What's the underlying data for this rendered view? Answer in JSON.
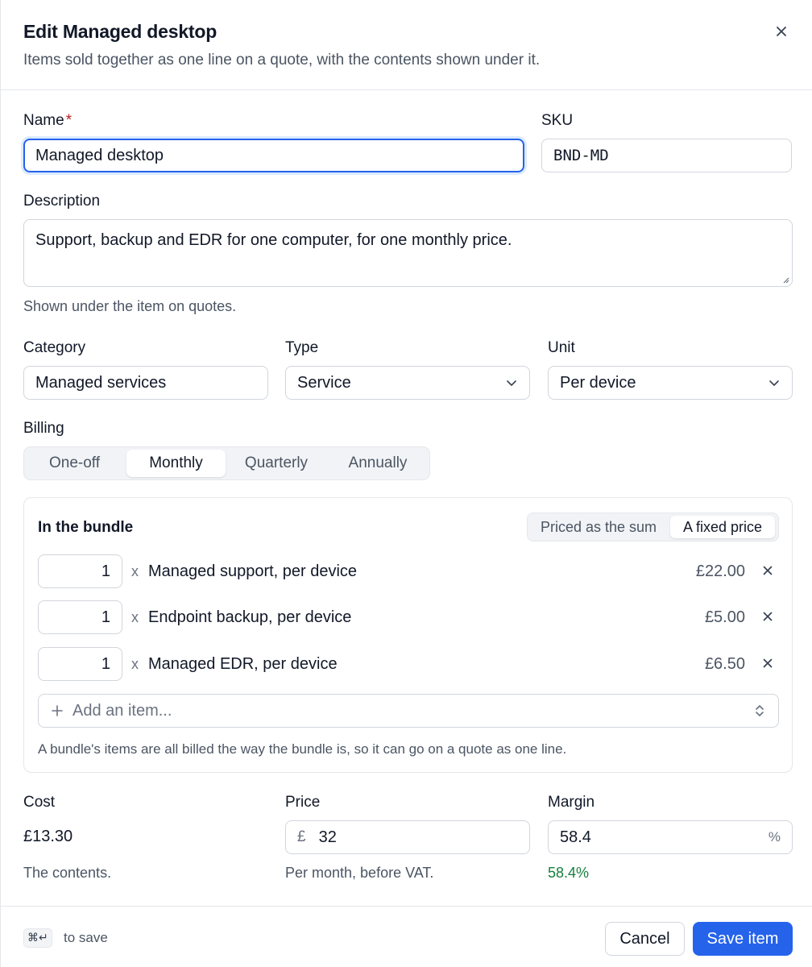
{
  "dialog": {
    "title": "Edit Managed desktop",
    "subtitle": "Items sold together as one line on a quote, with the contents shown under it."
  },
  "fields": {
    "name": {
      "label": "Name",
      "required_mark": "*",
      "value": "Managed desktop"
    },
    "sku": {
      "label": "SKU",
      "value": "BND-MD"
    },
    "description": {
      "label": "Description",
      "value": "Support, backup and EDR for one computer, for one monthly price.",
      "hint": "Shown under the item on quotes."
    },
    "category": {
      "label": "Category",
      "value": "Managed services"
    },
    "type": {
      "label": "Type",
      "value": "Service"
    },
    "unit": {
      "label": "Unit",
      "value": "Per device"
    }
  },
  "billing": {
    "label": "Billing",
    "options": [
      "One-off",
      "Monthly",
      "Quarterly",
      "Annually"
    ],
    "selected": "Monthly"
  },
  "bundle": {
    "title": "In the bundle",
    "pricing_options": [
      "Priced as the sum",
      "A fixed price"
    ],
    "pricing_selected": "A fixed price",
    "times_symbol": "x",
    "items": [
      {
        "qty": "1",
        "name": "Managed support, per device",
        "price": "£22.00"
      },
      {
        "qty": "1",
        "name": "Endpoint backup, per device",
        "price": "£5.00"
      },
      {
        "qty": "1",
        "name": "Managed EDR, per device",
        "price": "£6.50"
      }
    ],
    "add_placeholder": "Add an item...",
    "hint": "A bundle's items are all billed the way the bundle is, so it can go on a quote as one line."
  },
  "pricing": {
    "cost": {
      "label": "Cost",
      "value": "£13.30",
      "hint": "The contents."
    },
    "price": {
      "label": "Price",
      "prefix": "£",
      "value": "32",
      "hint": "Per month, before VAT."
    },
    "margin": {
      "label": "Margin",
      "value": "58.4",
      "suffix": "%",
      "display": "58.4%"
    }
  },
  "footer": {
    "shortcut": "⌘↵",
    "shortcut_hint": "to save",
    "cancel_label": "Cancel",
    "save_label": "Save item"
  },
  "colors": {
    "accent": "#2563eb",
    "required": "#b91c1c",
    "margin_positive": "#15803d"
  },
  "icons": [
    "close-icon",
    "chevron-down-icon",
    "plus-icon",
    "chevron-up-down-icon",
    "remove-icon",
    "resize-grip-icon"
  ]
}
